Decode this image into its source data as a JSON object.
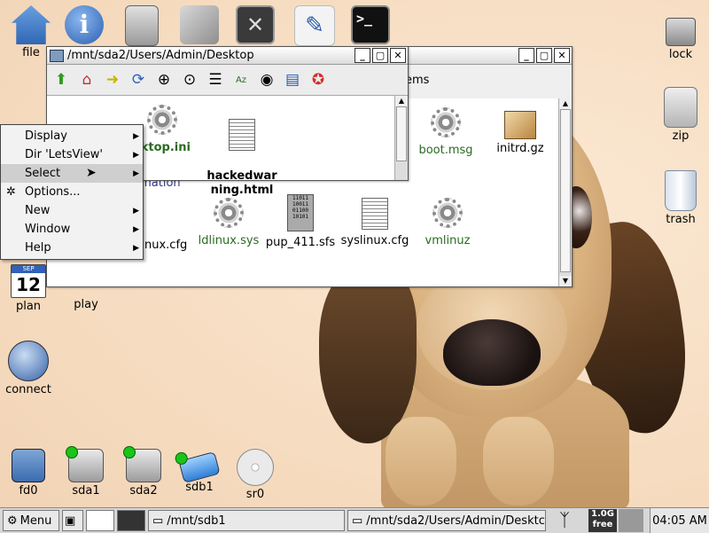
{
  "desktop": {
    "top_icons": [
      {
        "label": "file",
        "icon": "home-icon"
      },
      {
        "label": "",
        "icon": "info-icon"
      },
      {
        "label": "",
        "icon": "drive-icon"
      },
      {
        "label": "",
        "icon": "package-icon"
      },
      {
        "label": "",
        "icon": "setup-icon"
      },
      {
        "label": "",
        "icon": "edit-icon"
      },
      {
        "label": "",
        "icon": "console-icon"
      }
    ],
    "left_icons": [
      {
        "label": "plan",
        "icon": "calendar-icon",
        "day": "12",
        "month": "SEP"
      },
      {
        "label": "play",
        "icon": "play-icon"
      },
      {
        "label": "connect",
        "icon": "connect-icon"
      }
    ],
    "right_icons": [
      {
        "label": "lock",
        "icon": "lock-icon"
      },
      {
        "label": "zip",
        "icon": "zip-icon"
      },
      {
        "label": "trash",
        "icon": "trash-icon"
      }
    ],
    "drive_icons": [
      {
        "label": "fd0",
        "icon": "floppy-icon"
      },
      {
        "label": "sda1",
        "icon": "hdd-icon"
      },
      {
        "label": "sda2",
        "icon": "hdd-icon"
      },
      {
        "label": "sdb1",
        "icon": "usb-icon"
      },
      {
        "label": "sr0",
        "icon": "cdrom-icon"
      }
    ]
  },
  "back_window": {
    "title": "/mnt/sda2/Users/Admin/Desktop",
    "info_fragment": "ems",
    "files": [
      {
        "label": "boot.msg",
        "type": "gear",
        "color": "green"
      },
      {
        "label": "initrd.gz",
        "type": "package",
        "color": "black"
      },
      {
        "label": "ldlinux.sys",
        "type": "gear",
        "color": "green"
      },
      {
        "label": "pup_411.sfs",
        "type": "binary",
        "color": "black",
        "binary_text": "11011\n10011\n01100\n10101"
      },
      {
        "label": "syslinux.cfg",
        "type": "doc",
        "color": "black"
      },
      {
        "label": "vmlinuz",
        "type": "gear",
        "color": "green"
      }
    ],
    "partial_labels": {
      "left_cfg": "nux.cfg",
      "left_info": "rmation"
    }
  },
  "front_window": {
    "title": "/mnt/sda2/Users/Admin/Desktop",
    "toolbar": [
      "up-arrow-icon",
      "home-icon",
      "go-icon",
      "refresh-icon",
      "zoom-in-icon",
      "zoom-fit-icon",
      "list-icon",
      "sort-icon",
      "eye-icon",
      "details-icon",
      "help-icon"
    ],
    "files": [
      {
        "label": "sktop.ini",
        "type": "gear",
        "color": "green"
      },
      {
        "label": "hackedwar\nning.html",
        "type": "doc",
        "color": "black"
      }
    ]
  },
  "context_menu": {
    "items": [
      {
        "label": "Display",
        "submenu": true
      },
      {
        "label": "Dir 'LetsView'",
        "submenu": true
      },
      {
        "label": "Select",
        "submenu": true,
        "selected": true
      },
      {
        "label": "Options...",
        "submenu": false,
        "icon": "options-icon"
      },
      {
        "label": "New",
        "submenu": true
      },
      {
        "label": "Window",
        "submenu": true
      },
      {
        "label": "Help",
        "submenu": true
      }
    ]
  },
  "taskbar": {
    "menu_label": "Menu",
    "tasks": [
      "/mnt/sdb1",
      "/mnt/sda2/Users/Admin/Desktc"
    ],
    "free_top": "1.0G",
    "free_bottom": "free",
    "clock": "04:05 AM"
  },
  "colors": {
    "green_label": "#2a6b20",
    "wallpaper": "#f8e2c8",
    "selected_menu": "#cfcfcf"
  }
}
